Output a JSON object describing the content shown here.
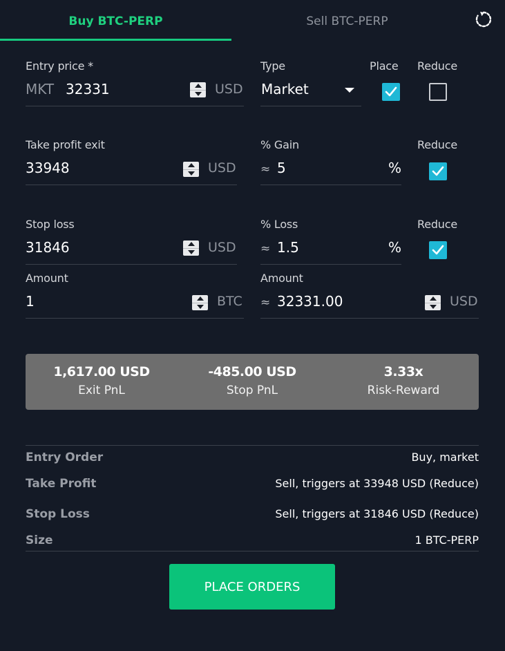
{
  "tabs": {
    "buy": "Buy BTC-PERP",
    "sell": "Sell BTC-PERP"
  },
  "icons": {
    "reset": "rotate-ccw-icon",
    "stepper": "spin-stepper-icon",
    "check": "checkmark-icon",
    "dropdown": "caret-down-icon"
  },
  "colors": {
    "accent": "#17c97f",
    "checkbox": "#1fb8d6",
    "button": "#0bc37a",
    "summary_bg": "#6e6e6e",
    "background": "#141a26"
  },
  "entry": {
    "label": "Entry price *",
    "prefix": "MKT",
    "value": "32331",
    "unit": "USD",
    "type_label": "Type",
    "type_value": "Market",
    "place_label": "Place",
    "place_checked": true,
    "reduce_label": "Reduce",
    "reduce_checked": false
  },
  "take_profit": {
    "label": "Take profit exit",
    "value": "33948",
    "unit": "USD",
    "gain_label": "% Gain",
    "approx": "≈",
    "gain_value": "5",
    "gain_unit": "%",
    "reduce_label": "Reduce",
    "reduce_checked": true
  },
  "stop_loss": {
    "label": "Stop loss",
    "value": "31846",
    "unit": "USD",
    "loss_label": "% Loss",
    "approx": "≈",
    "loss_value": "1.5",
    "loss_unit": "%",
    "reduce_label": "Reduce",
    "reduce_checked": true
  },
  "amount": {
    "label": "Amount",
    "value": "1",
    "unit": "BTC",
    "usd_label": "Amount",
    "approx": "≈",
    "usd_value": "32331.00",
    "usd_unit": "USD"
  },
  "summary": {
    "exit_pnl_value": "1,617.00 USD",
    "exit_pnl_label": "Exit PnL",
    "stop_pnl_value": "-485.00 USD",
    "stop_pnl_label": "Stop PnL",
    "risk_reward_value": "3.33x",
    "risk_reward_label": "Risk-Reward"
  },
  "orders": [
    {
      "key": "Entry Order",
      "value": "Buy, market"
    },
    {
      "key": "Take Profit",
      "value": "Sell, triggers at 33948 USD (Reduce)"
    },
    {
      "key": "Stop Loss",
      "value": "Sell, triggers at 31846 USD (Reduce)"
    },
    {
      "key": "Size",
      "value": "1 BTC-PERP"
    }
  ],
  "place_orders_label": "PLACE ORDERS"
}
